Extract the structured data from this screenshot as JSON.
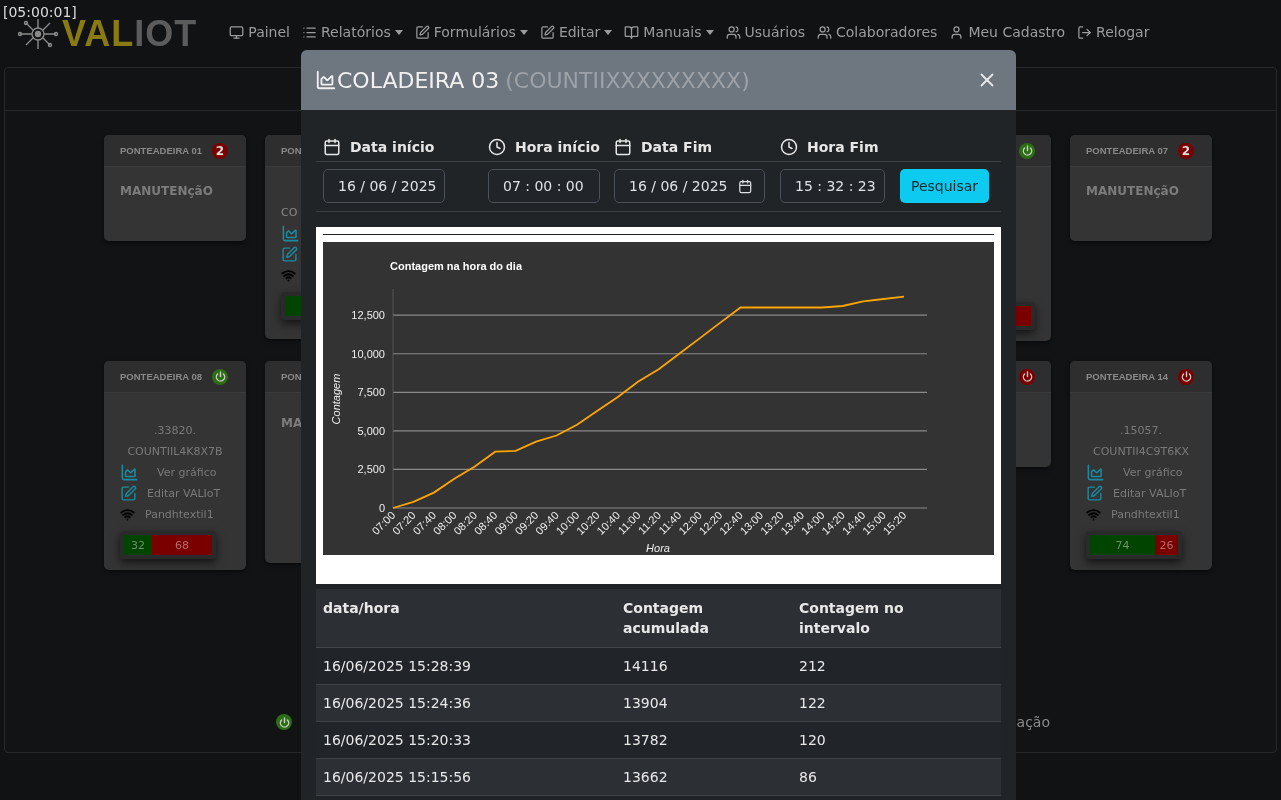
{
  "clock": "[05:00:01]",
  "logo": [
    "VAL",
    "IOT"
  ],
  "nav": [
    {
      "label": "Painel",
      "dropdown": false
    },
    {
      "label": "Relatórios",
      "dropdown": true
    },
    {
      "label": "Formulários",
      "dropdown": true
    },
    {
      "label": "Editar",
      "dropdown": true
    },
    {
      "label": "Manuais",
      "dropdown": true
    },
    {
      "label": "Usuários",
      "dropdown": false
    },
    {
      "label": "Colaboradores",
      "dropdown": false
    },
    {
      "label": "Meu Cadastro",
      "dropdown": false
    },
    {
      "label": "Relogar",
      "dropdown": false
    }
  ],
  "card_rows": [
    {
      "left": [
        {
          "kind": "maintenance",
          "name": "PONTEADEIRA 01",
          "badge": "2",
          "text": "MANUTENçãO"
        },
        {
          "kind": "clipped",
          "name": "PON",
          "lines": [
            "CO"
          ],
          "links": true,
          "bar": true
        }
      ],
      "right": [
        {
          "kind": "clipped_right",
          "on": true,
          "bar": true
        },
        {
          "kind": "maintenance",
          "name": "PONTEADEIRA 07",
          "badge": "2",
          "text": "MANUTENçãO"
        }
      ]
    },
    {
      "left": [
        {
          "kind": "device",
          "name": "PONTEADEIRA 08",
          "on": true,
          "code": ".33820.",
          "serial": "COUNTIIL4K8X7B",
          "chart_link": "Ver gráfico",
          "edit_link": "Editar VALIoT",
          "wifi": "Pandhtextil1",
          "good": "32",
          "bad": "68",
          "level": 0.32
        },
        {
          "kind": "clipped",
          "name": "PON",
          "title": "MA"
        }
      ],
      "right": [
        {
          "kind": "clipped_right",
          "on": false
        },
        {
          "kind": "device",
          "name": "PONTEADEIRA 14",
          "on": false,
          "code": ".15057.",
          "serial": "COUNTII4C9T6KX",
          "chart_link": "Ver gráfico",
          "edit_link": "Editar VALIoT",
          "wifi": "Pandhtextil1",
          "good": "74",
          "bad": "26",
          "level": 0.74
        }
      ]
    }
  ],
  "legend": [
    {
      "on": true
    },
    {
      "label": "ação"
    }
  ],
  "modal": {
    "title": "COLADEIRA 03",
    "subtitle": "(COUNTIIXXXXXXXXX)",
    "filters": [
      {
        "label": "Data início",
        "value": "16 / 06 / 2025",
        "kind": "date"
      },
      {
        "label": "Hora início",
        "value": "07 : 00 : 00",
        "kind": "time"
      },
      {
        "label": "Data Fim",
        "value": "16 / 06 / 2025",
        "kind": "date"
      },
      {
        "label": "Hora Fim",
        "value": "15 : 32 : 23",
        "kind": "time"
      }
    ],
    "search_button": "Pesquisar",
    "chart_data": {
      "type": "line",
      "title": "Contagem na hora do dia",
      "xlabel": "Hora",
      "ylabel": "Contagem",
      "grid": true,
      "ylim": [
        0,
        14200
      ],
      "categories": [
        "07:00",
        "07:20",
        "07:40",
        "08:00",
        "08:20",
        "08:40",
        "09:00",
        "09:20",
        "09:40",
        "10:00",
        "10:20",
        "10:40",
        "11:00",
        "11:20",
        "11:40",
        "12:00",
        "12:20",
        "12:40",
        "13:00",
        "13:20",
        "13:40",
        "14:00",
        "14:20",
        "14:40",
        "15:00",
        "15:20"
      ],
      "series": [
        {
          "color": "#ffa500",
          "values": [
            0,
            400,
            1000,
            1900,
            2700,
            3650,
            3700,
            4300,
            4700,
            5400,
            6300,
            7200,
            8200,
            9000,
            10000,
            11000,
            12000,
            13000,
            13000,
            13000,
            13000,
            13000,
            13100,
            13400,
            13550,
            13700
          ]
        }
      ],
      "yticks": [
        {
          "value": 0,
          "label": "0"
        },
        {
          "value": 2500,
          "label": "2,500"
        },
        {
          "value": 5000,
          "label": "5,000"
        },
        {
          "value": 7500,
          "label": "7,500"
        },
        {
          "value": 10000,
          "label": "10,000"
        },
        {
          "value": 12500,
          "label": "12,500"
        }
      ]
    },
    "table": {
      "columns": [
        "data/hora",
        "Contagem acumulada",
        "Contagem no intervalo"
      ],
      "rows": [
        [
          "16/06/2025 15:28:39",
          "14116",
          "212"
        ],
        [
          "16/06/2025 15:24:36",
          "13904",
          "122"
        ],
        [
          "16/06/2025 15:20:33",
          "13782",
          "120"
        ],
        [
          "16/06/2025 15:15:56",
          "13662",
          "86"
        ]
      ]
    }
  }
}
